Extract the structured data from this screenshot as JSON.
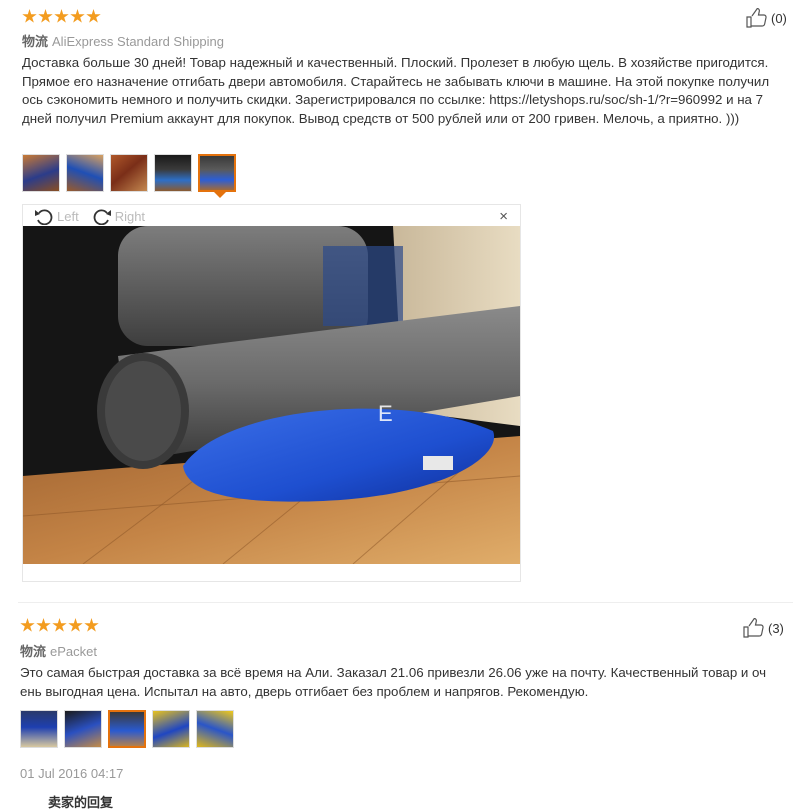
{
  "reviews": [
    {
      "rating": 5,
      "shipping_label": "物流",
      "shipping_method": "AliExpress Standard Shipping",
      "helpful_count": "(0)",
      "text": "Доставка больше 30 дней! Товар надежный и качественный. Плоский. Пролезет в любую щель. В хозяйстве пригодится. Прямое его назначение отгибать двери автомобиля. Старайтесь не забывать ключи в машине. На этой покупке получилось сэкономить немного и получить скидки. Зарегистрировался по ссылке: https://letyshops.ru/soc/sh-1/?r=960992 и на 7 дней получил Premium аккаунт для покупок. Вывод средств от 500 рублей или от 200 гривен. Мелочь, а приятно. )))",
      "photo_count": 5,
      "selected_photo": 5,
      "viewer": {
        "rotate_left": "Left",
        "rotate_right": "Right",
        "close": "×"
      }
    },
    {
      "rating": 5,
      "shipping_label": "物流",
      "shipping_method": "ePacket",
      "helpful_count": "(3)",
      "text": "Это самая быстрая доставка за всё время на Али. Заказал 21.06 привезли 26.06 уже на почту. Качественный товар и очень выгодная цена. Испытал на авто, дверь отгибает без проблем и напрягов. Рекомендую.",
      "photo_count": 5,
      "selected_photo": 3,
      "date": "01 Jul 2016 04:17"
    }
  ],
  "footer_partial": "卖家的回复",
  "colors": {
    "star": "#f39c1f",
    "selected_border": "#e4720d",
    "muted": "#999999"
  }
}
